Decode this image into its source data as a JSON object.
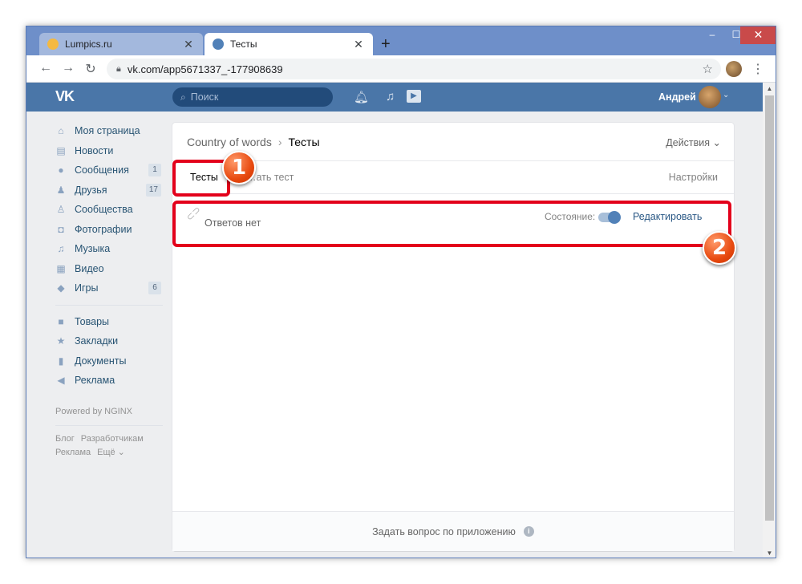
{
  "browser": {
    "tabs": [
      {
        "title": "Lumpics.ru",
        "favicon_color": "#f4b942",
        "active": false
      },
      {
        "title": "Тесты",
        "favicon_color": "#5181b8",
        "active": true
      }
    ],
    "close_glyph": "✕",
    "new_tab_glyph": "+",
    "window_controls": {
      "minimize": "–",
      "maximize": "☐",
      "close": "✕"
    },
    "url": "vk.com/app5671337_-177908639",
    "nav": {
      "back": "←",
      "forward": "→",
      "reload": "↻",
      "star": "☆",
      "menu": "⋮"
    }
  },
  "vk": {
    "logo": "VK",
    "search_placeholder": "Поиск",
    "user_name": "Андрей",
    "header_icons": [
      "bell-icon",
      "music-icon",
      "play-icon"
    ]
  },
  "sidebar": {
    "items": [
      {
        "label": "Моя страница",
        "icon": "home-icon",
        "count": ""
      },
      {
        "label": "Новости",
        "icon": "news-icon",
        "count": ""
      },
      {
        "label": "Сообщения",
        "icon": "messages-icon",
        "count": "1"
      },
      {
        "label": "Друзья",
        "icon": "friends-icon",
        "count": "17"
      },
      {
        "label": "Сообщества",
        "icon": "communities-icon",
        "count": ""
      },
      {
        "label": "Фотографии",
        "icon": "camera-icon",
        "count": ""
      },
      {
        "label": "Музыка",
        "icon": "music-icon",
        "count": ""
      },
      {
        "label": "Видео",
        "icon": "video-icon",
        "count": ""
      },
      {
        "label": "Игры",
        "icon": "gamepad-icon",
        "count": "6"
      }
    ],
    "items2": [
      {
        "label": "Товары",
        "icon": "bag-icon"
      },
      {
        "label": "Закладки",
        "icon": "star-icon"
      },
      {
        "label": "Документы",
        "icon": "document-icon"
      },
      {
        "label": "Реклама",
        "icon": "megaphone-icon"
      }
    ],
    "powered": "Powered by NGINX",
    "footer_links": [
      "Блог",
      "Разработчикам",
      "Реклама",
      "Ещё ⌄"
    ]
  },
  "card": {
    "breadcrumb_parent": "Country of words",
    "breadcrumb_sep": "›",
    "breadcrumb_current": "Тесты",
    "actions_label": "Действия ⌄",
    "tab_tests": "Тесты",
    "tab_create": "…ать тест",
    "settings_label": "Настройки",
    "row": {
      "no_answers": "Ответов нет",
      "state_label": "Состояние:",
      "toggle_on": true,
      "edit_label": "Редактировать"
    },
    "footer_label": "Задать вопрос по приложению",
    "footer_info": "i"
  },
  "annotations": [
    {
      "number": "1"
    },
    {
      "number": "2"
    }
  ],
  "colors": {
    "vk_blue": "#4a76a8",
    "highlight_red": "#e3001b",
    "badge_orange": "#e84a10"
  }
}
